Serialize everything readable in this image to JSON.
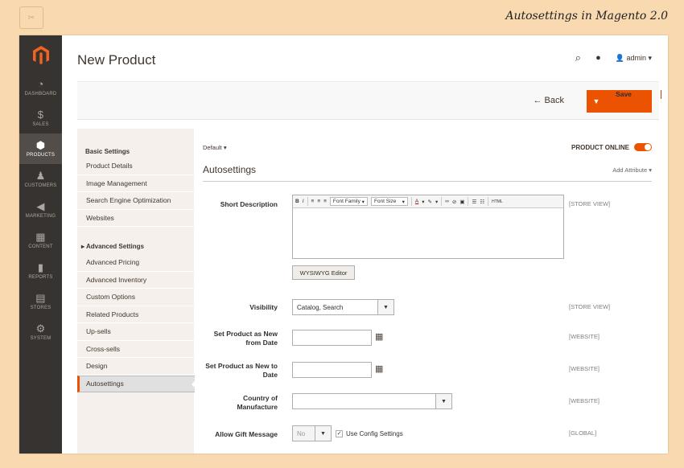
{
  "caption": "Autosettings in Magento 2.0",
  "nav": [
    {
      "label": "DASHBOARD",
      "icon": "dashboard-icon",
      "glyph": "◔"
    },
    {
      "label": "SALES",
      "icon": "dollar-icon",
      "glyph": "$"
    },
    {
      "label": "PRODUCTS",
      "icon": "cube-icon",
      "glyph": "⬢"
    },
    {
      "label": "CUSTOMERS",
      "icon": "person-icon",
      "glyph": "♟"
    },
    {
      "label": "MARKETING",
      "icon": "megaphone-icon",
      "glyph": "◀"
    },
    {
      "label": "CONTENT",
      "icon": "layout-icon",
      "glyph": "▦"
    },
    {
      "label": "REPORTS",
      "icon": "bar-chart-icon",
      "glyph": "▮"
    },
    {
      "label": "STORES",
      "icon": "store-icon",
      "glyph": "▤"
    },
    {
      "label": "SYSTEM",
      "icon": "gear-icon",
      "glyph": "⚙"
    }
  ],
  "header": {
    "title": "New Product",
    "user": "admin"
  },
  "actions": {
    "back": "Back",
    "save": "Save"
  },
  "tabs": {
    "basic_title": "Basic Settings",
    "basic": [
      "Product Details",
      "Image Management",
      "Search Engine Optimization",
      "Websites"
    ],
    "advanced_title": "Advanced Settings",
    "advanced": [
      "Advanced Pricing",
      "Advanced Inventory",
      "Custom Options",
      "Related Products",
      "Up-sells",
      "Cross-sells",
      "Design",
      "Autosettings"
    ]
  },
  "form": {
    "scope": "Default",
    "online": "PRODUCT ONLINE",
    "title": "Autosettings",
    "add_attribute": "Add Attribute",
    "short_desc": "Short Description",
    "font_family": "Font Family",
    "font_size": "Font Size",
    "wysiwyg": "WYSIWYG Editor",
    "visibility": "Visibility",
    "visibility_value": "Catalog, Search",
    "new_from": "Set Product as New from Date",
    "new_to": "Set Product as New to Date",
    "country": "Country of Manufacture",
    "gift": "Allow Gift Message",
    "gift_value": "No",
    "use_config": "Use Config Settings",
    "scope_store": "[STORE VIEW]",
    "scope_website": "[WEBSITE]",
    "scope_global": "[GLOBAL]"
  }
}
